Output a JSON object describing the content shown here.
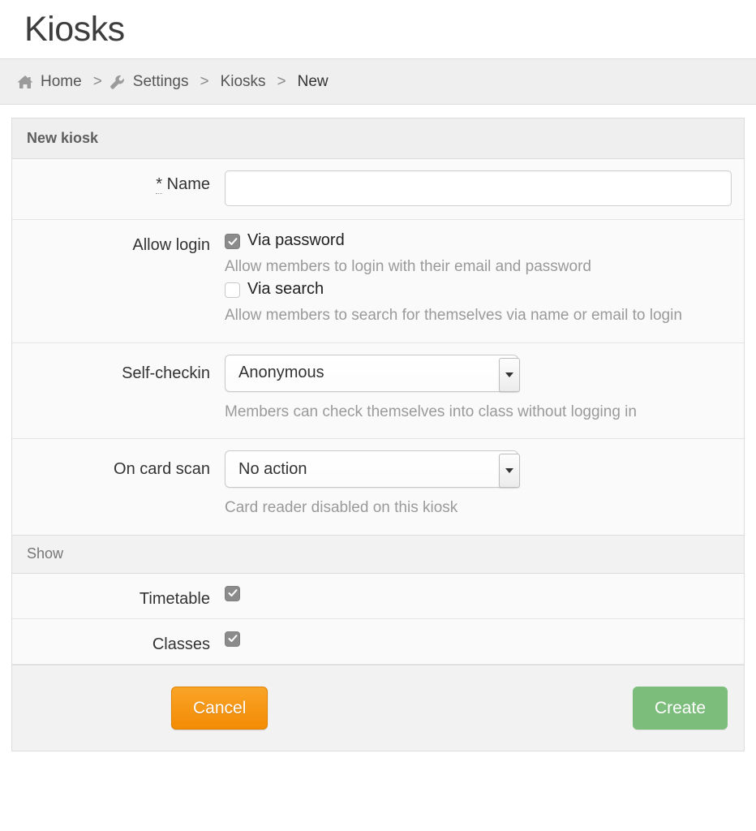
{
  "page": {
    "title": "Kiosks"
  },
  "breadcrumb": {
    "home_icon": "home-icon",
    "home_label": "Home",
    "sep": ">",
    "settings_icon": "wrench-icon",
    "settings_label": "Settings",
    "kiosks_label": "Kiosks",
    "current_label": "New"
  },
  "panel": {
    "heading": "New kiosk",
    "section_heading": "Show"
  },
  "form": {
    "name": {
      "required_mark": "*",
      "label": "Name",
      "value": "",
      "placeholder": ""
    },
    "allow_login": {
      "label": "Allow login",
      "options": [
        {
          "label": "Via password",
          "checked": true,
          "help": "Allow members to login with their email and password"
        },
        {
          "label": "Via search",
          "checked": false,
          "help": "Allow members to search for themselves via name or email to login"
        }
      ]
    },
    "self_checkin": {
      "label": "Self-checkin",
      "value": "Anonymous",
      "help": "Members can check themselves into class without logging in"
    },
    "on_card_scan": {
      "label": "On card scan",
      "value": "No action",
      "help": "Card reader disabled on this kiosk"
    },
    "show": {
      "timetable": {
        "label": "Timetable",
        "checked": true
      },
      "classes": {
        "label": "Classes",
        "checked": true
      }
    }
  },
  "footer": {
    "cancel_label": "Cancel",
    "create_label": "Create"
  },
  "colors": {
    "cancel_orange": "#f59c1a",
    "create_green": "#7cbd7c",
    "panel_bg": "#fafafa",
    "heading_bg": "#efefef",
    "help_text": "#9a9a9a"
  }
}
